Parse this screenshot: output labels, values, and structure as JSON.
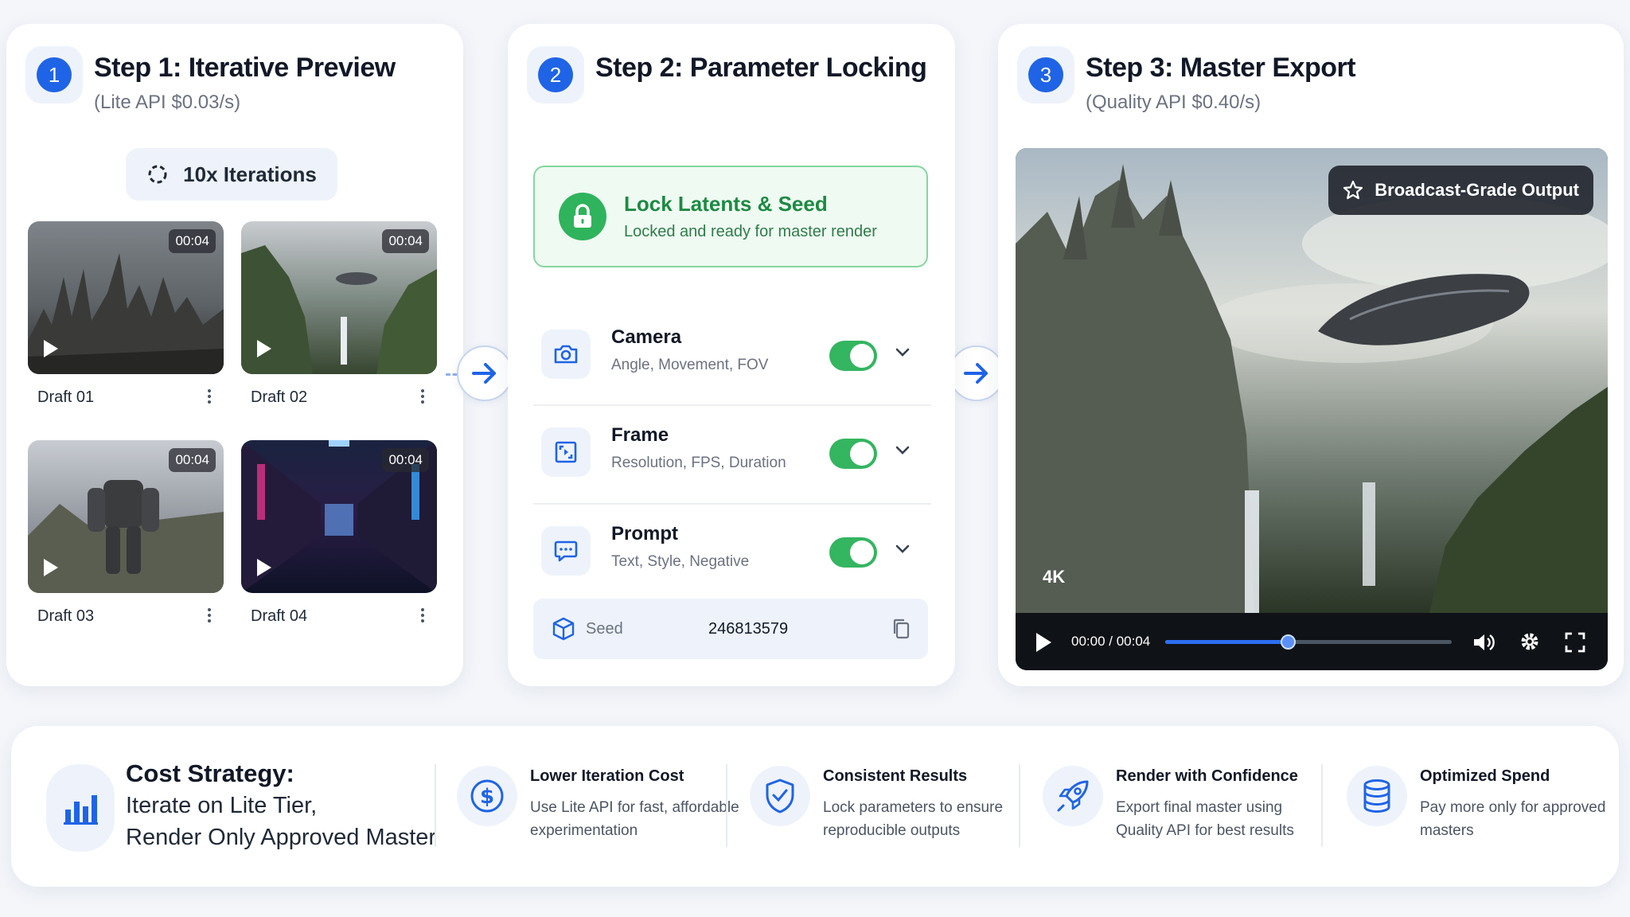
{
  "step1": {
    "number": "1",
    "title": "Step 1: Iterative Preview",
    "subtitle": "(Lite API $0.03/s)",
    "iterations_label": "10x Iterations",
    "drafts": [
      {
        "label": "Draft 01",
        "duration": "00:04"
      },
      {
        "label": "Draft 02",
        "duration": "00:04"
      },
      {
        "label": "Draft 03",
        "duration": "00:04"
      },
      {
        "label": "Draft 04",
        "duration": "00:04"
      }
    ]
  },
  "step2": {
    "number": "2",
    "title": "Step 2: Parameter Locking",
    "lock": {
      "title": "Lock Latents & Seed",
      "subtitle": "Locked and ready for master render"
    },
    "params": [
      {
        "title": "Camera",
        "subtitle": "Angle, Movement, FOV",
        "icon": "camera-icon",
        "enabled": true
      },
      {
        "title": "Frame",
        "subtitle": "Resolution, FPS, Duration",
        "icon": "frame-icon",
        "enabled": true
      },
      {
        "title": "Prompt",
        "subtitle": "Text, Style, Negative",
        "icon": "chat-icon",
        "enabled": true
      }
    ],
    "seed": {
      "label": "Seed",
      "value": "246813579"
    }
  },
  "step3": {
    "number": "3",
    "title": "Step 3: Master Export",
    "subtitle": "(Quality API $0.40/s)",
    "badge": "Broadcast-Grade Output",
    "resolution": "4K",
    "time": "00:00 / 00:04",
    "progress": 0.43
  },
  "cost": {
    "title": "Cost Strategy:",
    "line1": "Iterate on Lite Tier,",
    "line2": "Render Only Approved Master",
    "features": [
      {
        "title": "Lower Iteration Cost",
        "desc": "Use Lite API for fast, affordable experimentation",
        "icon": "dollar-icon"
      },
      {
        "title": "Consistent Results",
        "desc": "Lock parameters to ensure reproducible outputs",
        "icon": "shield-check-icon"
      },
      {
        "title": "Render with Confidence",
        "desc": "Export final master using Quality API for best results",
        "icon": "rocket-icon"
      },
      {
        "title": "Optimized Spend",
        "desc": "Pay more only for approved masters",
        "icon": "database-icon"
      }
    ]
  },
  "colors": {
    "accent": "#1f64e6",
    "success": "#34b560",
    "lockText": "#1d8a43"
  }
}
